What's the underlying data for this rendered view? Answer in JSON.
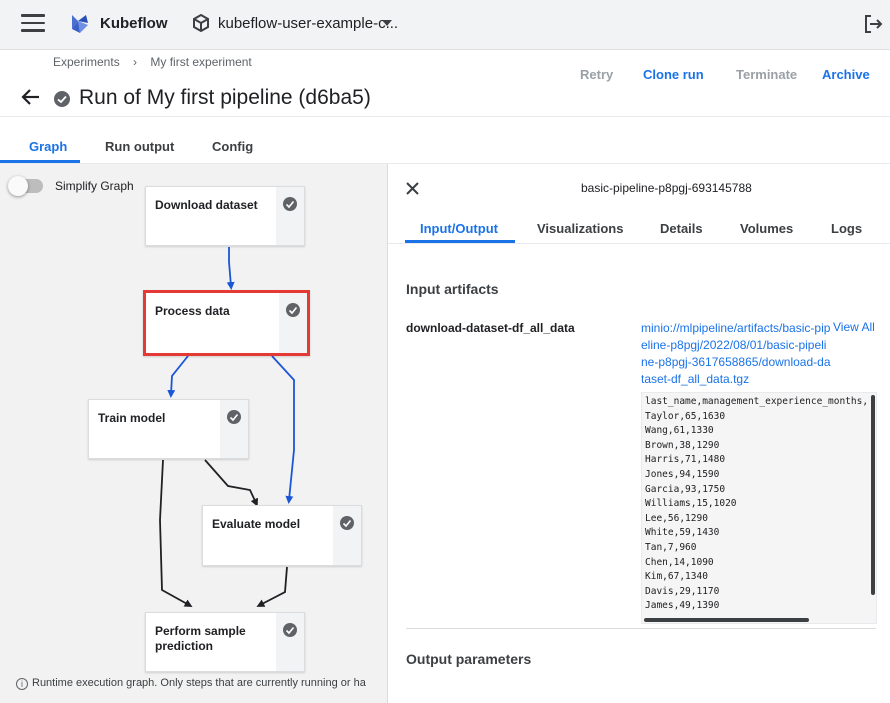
{
  "topbar": {
    "brand": "Kubeflow",
    "namespace": "kubeflow-user-example-c..."
  },
  "header": {
    "breadcrumb": [
      "Experiments",
      "My first experiment"
    ],
    "title": "Run of My first pipeline (d6ba5)",
    "actions": {
      "retry": "Retry",
      "clone": "Clone run",
      "terminate": "Terminate",
      "archive": "Archive"
    }
  },
  "tabs": {
    "graph": "Graph",
    "run_output": "Run output",
    "config": "Config"
  },
  "graph": {
    "simplify_label": "Simplify Graph",
    "nodes": {
      "download": "Download dataset",
      "process": "Process data",
      "train": "Train model",
      "evaluate": "Evaluate model",
      "predict_line1": "Perform sample",
      "predict_line2": "prediction"
    },
    "footnote": "Runtime execution graph. Only steps that are currently running or ha"
  },
  "panel": {
    "title": "basic-pipeline-p8pgj-693145788",
    "tabs": {
      "io": "Input/Output",
      "visualizations": "Visualizations",
      "details": "Details",
      "volumes": "Volumes",
      "logs": "Logs"
    },
    "input_artifacts_heading": "Input artifacts",
    "artifact_name": "download-dataset-df_all_data",
    "artifact_link": "minio://mlpipeline/artifacts/basic-pipeline-p8pgj/2022/08/01/basic-pipeline-p8pgj-3617658865/download-dataset-df_all_data.tgz",
    "view_all": "View All",
    "preview_lines": [
      "last_name,management_experience_months,",
      "Taylor,65,1630",
      "Wang,61,1330",
      "Brown,38,1290",
      "Harris,71,1480",
      "Jones,94,1590",
      "Garcia,93,1750",
      "Williams,15,1020",
      "Lee,56,1290",
      "White,59,1430",
      "Tan,7,960",
      "Chen,14,1090",
      "Kim,67,1340",
      "Davis,29,1170",
      "James,49,1390"
    ],
    "output_parameters_heading": "Output parameters"
  },
  "colors": {
    "accent": "#1a73e8",
    "selected_border": "#e53935",
    "edge_blue": "#1a56d6",
    "edge_dark": "#202124"
  }
}
